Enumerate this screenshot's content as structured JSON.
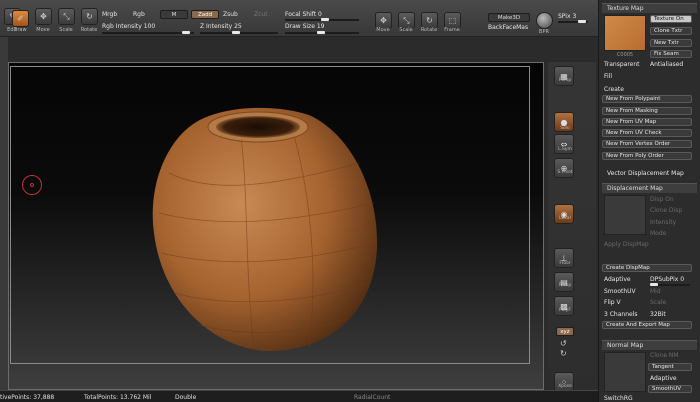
{
  "toolbar": {
    "tools": [
      {
        "label": "Edit",
        "icon": "edit-icon"
      },
      {
        "label": "Draw",
        "icon": "draw-icon"
      },
      {
        "label": "Move",
        "icon": "move-icon"
      },
      {
        "label": "Scale",
        "icon": "scale-icon"
      },
      {
        "label": "Rotate",
        "icon": "rotate-icon"
      }
    ],
    "mrgb": "Mrgb",
    "rgb": "Rgb",
    "m": "M",
    "zadd": "Zadd",
    "zsub": "Zsub",
    "zcut": "Zcut",
    "rgb_intensity_label": "Rgb Intensity",
    "rgb_intensity_value": "100",
    "z_intensity_label": "Z Intensity",
    "z_intensity_value": "25",
    "focal_shift_label": "Focal Shift",
    "focal_shift_value": "0",
    "draw_size_label": "Draw Size",
    "draw_size_value": "19",
    "right_tools": [
      {
        "label": "Move",
        "icon": "move-icon"
      },
      {
        "label": "Scale",
        "icon": "scale-icon"
      },
      {
        "label": "Rotate",
        "icon": "rotate-icon"
      },
      {
        "label": "Frame",
        "icon": "frame-icon"
      }
    ],
    "make3d": "Make3D",
    "backfacemask": "BackFaceMas",
    "bpr": "BPR",
    "spix_label": "SPix",
    "spix_value": "3"
  },
  "shelf": {
    "items": [
      {
        "label": "Persp",
        "icon": "persp-icon"
      },
      {
        "label": "Solo",
        "icon": "solo-icon"
      },
      {
        "label": "L.Sym",
        "icon": "symmetry-icon"
      },
      {
        "label": "S.Pivot",
        "icon": "pivot-icon"
      },
      {
        "label": "Local",
        "icon": "local-icon"
      },
      {
        "label": "Floor",
        "icon": "floor-icon"
      },
      {
        "label": "Persp",
        "icon": "grid-icon"
      },
      {
        "label": "PolyF",
        "icon": "polyframe-icon"
      },
      {
        "label": "Xpose",
        "icon": "xpose-icon"
      }
    ],
    "xyz": "xyz"
  },
  "palette": {
    "texture_map": {
      "title": "Texture Map",
      "thumb_caption": "C0005",
      "texture_on": "Texture On",
      "clone_txtr": "Clone Txtr",
      "new_txtr": "New Txtr",
      "fix_seam": "Fix Seam",
      "transparent": "Transparent",
      "antialiased": "Antialiased",
      "fill": "Fill",
      "create": "Create",
      "create_buttons": [
        "New From Polypaint",
        "New From Masking",
        "New From UV Map",
        "New From UV Check",
        "New From Vertex Order",
        "New From Poly Order"
      ]
    },
    "vector_displacement_map": "Vector Displacement Map",
    "displacement_map": {
      "title": "Displacement Map",
      "disp_on": "Disp On",
      "clone_disp": "Clone Disp",
      "intensity": "Intensity",
      "mode": "Mode",
      "apply_dispmap": "Apply DispMap",
      "create_dispmap": "Create DispMap",
      "adaptive": "Adaptive",
      "dpsubpix_label": "DPSubPix",
      "dpsubpix_value": "0",
      "smoothuv": "SmoothUV",
      "mid": "Mid",
      "flip_v": "Flip V",
      "scale": "Scale",
      "channels": "3 Channels",
      "bit": "32Bit",
      "create_export": "Create And Export Map"
    },
    "normal_map": {
      "title": "Normal Map",
      "clone_nm": "Clone NM",
      "tangent": "Tangent",
      "adaptive": "Adaptive",
      "smoothuv": "SmoothUV",
      "switch_rg": "SwitchRG"
    }
  },
  "status": {
    "active_points": "tivePoints: 37,888",
    "total_points": "TotalPoints: 13.762 Mil",
    "double": "Double",
    "radial": "RadialCount"
  }
}
